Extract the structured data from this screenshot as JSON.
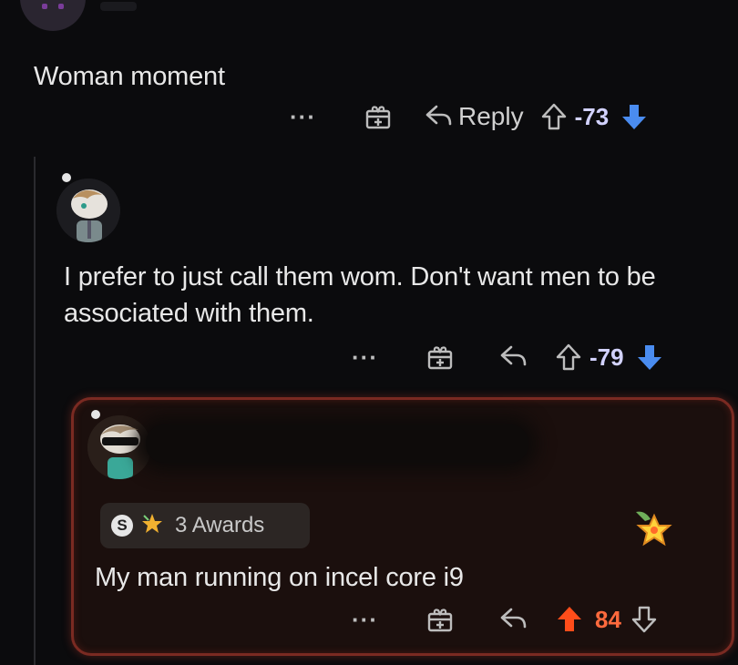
{
  "comments": [
    {
      "text": "Woman moment",
      "reply_label": "Reply",
      "score": "-73"
    },
    {
      "text": "I prefer to just call them wom. Don't want men to be associated with them.",
      "score": "-79"
    },
    {
      "awards_label": "3 Awards",
      "awards_badge": "S",
      "text": "My man running on incel core i9",
      "score": "84"
    }
  ],
  "colors": {
    "background": "#0b0b0d",
    "downvote": "#4a8cf0",
    "upvote_active": "#ff4d1a",
    "highlight_border": "#7a2a22"
  },
  "icons": [
    "more-dots-icon",
    "gift-icon",
    "reply-arrow-icon",
    "upvote-arrow-icon",
    "downvote-arrow-icon",
    "star-award-icon"
  ]
}
